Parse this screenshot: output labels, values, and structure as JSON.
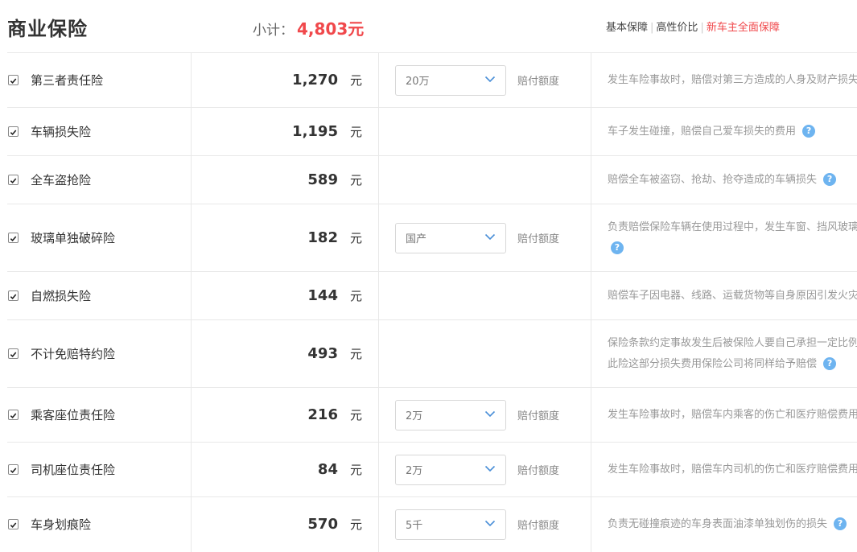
{
  "header": {
    "title": "商业保险",
    "subtotal_label": "小计：",
    "subtotal_value": "4,803元",
    "links": [
      "基本保障",
      "高性价比",
      "新车主全面保障"
    ],
    "link_separator": "|"
  },
  "rows": [
    {
      "name": "第三者责任险",
      "price": "1,270",
      "unit": "元",
      "select": "20万",
      "select_label": "赔付额度",
      "desc": [
        "发生车险事故时，赔偿对第三方造成的人身及财产损失"
      ]
    },
    {
      "name": "车辆损失险",
      "price": "1,195",
      "unit": "元",
      "desc": [
        "车子发生碰撞，赔偿自己爱车损失的费用"
      ]
    },
    {
      "name": "全车盗抢险",
      "price": "589",
      "unit": "元",
      "desc": [
        "赔偿全车被盗窃、抢劫、抢夺造成的车辆损失"
      ]
    },
    {
      "name": "玻璃单独破碎险",
      "price": "182",
      "unit": "元",
      "select": "国产",
      "select_label": "赔付额度",
      "desc": [
        "负责赔偿保险车辆在使用过程中，发生车窗、挡风玻璃"
      ]
    },
    {
      "name": "自燃损失险",
      "price": "144",
      "unit": "元",
      "desc": [
        "赔偿车子因电器、线路、运载货物等自身原因引发火灾"
      ]
    },
    {
      "name": "不计免赔特约险",
      "price": "493",
      "unit": "元",
      "desc": [
        "保险条款约定事故发生后被保险人要自己承担一定比例",
        "此险这部分损失费用保险公司将同样给予赔偿"
      ]
    },
    {
      "name": "乘客座位责任险",
      "price": "216",
      "unit": "元",
      "select": "2万",
      "select_label": "赔付额度",
      "desc": [
        "发生车险事故时，赔偿车内乘客的伤亡和医疗赔偿费用"
      ]
    },
    {
      "name": "司机座位责任险",
      "price": "84",
      "unit": "元",
      "select": "2万",
      "select_label": "赔付额度",
      "desc": [
        "发生车险事故时，赔偿车内司机的伤亡和医疗赔偿费用"
      ]
    },
    {
      "name": "车身划痕险",
      "price": "570",
      "unit": "元",
      "select": "5千",
      "select_label": "赔付额度",
      "desc": [
        "负责无碰撞痕迹的车身表面油漆单独划伤的损失"
      ]
    }
  ],
  "icons": {
    "checkbox": "checkmark-icon",
    "dropdown": "chevron-down-icon",
    "help": "question-icon"
  },
  "colors": {
    "accent_red": "#f0484b",
    "help_blue": "#6eb4f0"
  }
}
